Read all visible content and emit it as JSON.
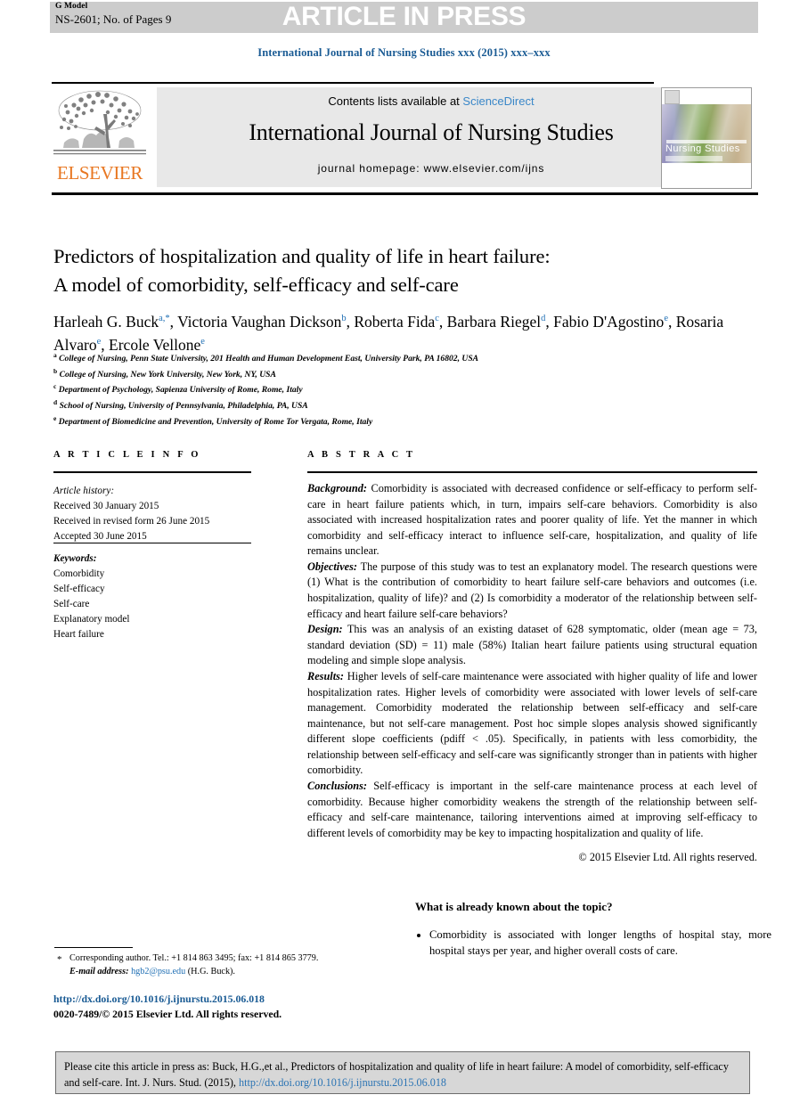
{
  "header": {
    "g_model_label": "G Model",
    "pages_line": "NS-2601; No. of Pages 9",
    "press_banner": "ARTICLE IN PRESS",
    "journal_ref": "International Journal of Nursing Studies xxx (2015) xxx–xxx"
  },
  "masthead": {
    "contents_prefix": "Contents lists available at ",
    "sciencedirect": "ScienceDirect",
    "journal_name": "International Journal of Nursing Studies",
    "homepage": "journal homepage: www.elsevier.com/ijns",
    "publisher": "ELSEVIER",
    "cover_title_main": "Nursing Studies"
  },
  "article": {
    "title_line_1": "Predictors of hospitalization and quality of life in heart failure:",
    "title_line_2": "A model of comorbidity, self-efficacy and self-care",
    "authors": [
      {
        "name": "Harleah G. Buck",
        "marks": "a,*",
        "sep": ", "
      },
      {
        "name": "Victoria Vaughan Dickson",
        "marks": "b",
        "sep": ", "
      },
      {
        "name": "Roberta Fida",
        "marks": "c",
        "sep": ", "
      },
      {
        "name": "Barbara Riegel",
        "marks": "d",
        "sep": ", "
      },
      {
        "name": "Fabio D'Agostino",
        "marks": "e",
        "sep": ", "
      },
      {
        "name": "Rosaria Alvaro",
        "marks": "e",
        "sep": ", "
      },
      {
        "name": "Ercole Vellone",
        "marks": "e",
        "sep": ""
      }
    ],
    "affiliations": [
      {
        "mark": "a",
        "text": "College of Nursing, Penn State University, 201 Health and Human Development East, University Park, PA 16802, USA"
      },
      {
        "mark": "b",
        "text": "College of Nursing, New York University, New York, NY, USA"
      },
      {
        "mark": "c",
        "text": "Department of Psychology, Sapienza University of Rome, Rome, Italy"
      },
      {
        "mark": "d",
        "text": "School of Nursing, University of Pennsylvania, Philadelphia, PA, USA"
      },
      {
        "mark": "e",
        "text": "Department of Biomedicine and Prevention, University of Rome Tor Vergata, Rome, Italy"
      }
    ]
  },
  "article_info": {
    "heading": "A R T I C L E   I N F O",
    "history_label": "Article history:",
    "history": [
      "Received 30 January 2015",
      "Received in revised form 26 June 2015",
      "Accepted 30 June 2015"
    ],
    "keywords_label": "Keywords:",
    "keywords": [
      "Comorbidity",
      "Self-efficacy",
      "Self-care",
      "Explanatory model",
      "Heart failure"
    ]
  },
  "abstract": {
    "heading": "A B S T R A C T",
    "sections": [
      {
        "label": "Background:",
        "text": " Comorbidity is associated with decreased confidence or self-efficacy to perform self-care in heart failure patients which, in turn, impairs self-care behaviors. Comorbidity is also associated with increased hospitalization rates and poorer quality of life. Yet the manner in which comorbidity and self-efficacy interact to influence self-care, hospitalization, and quality of life remains unclear."
      },
      {
        "label": "Objectives:",
        "text": " The purpose of this study was to test an explanatory model. The research questions were (1) What is the contribution of comorbidity to heart failure self-care behaviors and outcomes (i.e. hospitalization, quality of life)? and (2) Is comorbidity a moderator of the relationship between self-efficacy and heart failure self-care behaviors?"
      },
      {
        "label": "Design:",
        "text": " This was an analysis of an existing dataset of 628 symptomatic, older (mean age = 73, standard deviation (SD) = 11) male (58%) Italian heart failure patients using structural equation modeling and simple slope analysis."
      },
      {
        "label": "Results:",
        "text": " Higher levels of self-care maintenance were associated with higher quality of life and lower hospitalization rates. Higher levels of comorbidity were associated with lower levels of self-care management. Comorbidity moderated the relationship between self-efficacy and self-care maintenance, but not self-care management. Post hoc simple slopes analysis showed significantly different slope coefficients (pdiff < .05). Specifically, in patients with less comorbidity, the relationship between self-efficacy and self-care was significantly stronger than in patients with higher comorbidity."
      },
      {
        "label": "Conclusions:",
        "text": " Self-efficacy is important in the self-care maintenance process at each level of comorbidity. Because higher comorbidity weakens the strength of the relationship between self-efficacy and self-care maintenance, tailoring interventions aimed at improving self-efficacy to different levels of comorbidity may be key to impacting hospitalization and quality of life."
      }
    ],
    "copyright": "© 2015 Elsevier Ltd. All rights reserved."
  },
  "already_known": {
    "heading": "What is already known about the topic?",
    "bullets": [
      "Comorbidity is associated with longer lengths of hospital stay, more hospital stays per year, and higher overall costs of care."
    ]
  },
  "footnotes": {
    "star": "*",
    "corresponding": "Corresponding author. Tel.: +1 814 863 3495; fax: +1 814 865 3779.",
    "email_label": "E-mail address:",
    "email": "hgb2@psu.edu",
    "email_owner": " (H.G. Buck).",
    "doi": "http://dx.doi.org/10.1016/j.ijnurstu.2015.06.018",
    "issn": "0020-7489/© 2015 Elsevier Ltd. All rights reserved."
  },
  "cite_box": {
    "text_prefix": "Please cite this article in press as: Buck, H.G.,et al., Predictors of hospitalization and quality of life in heart failure: A model of comorbidity, self-efficacy and self-care. Int. J. Nurs. Stud. (2015), ",
    "link": "http://dx.doi.org/10.1016/j.ijnurstu.2015.06.018"
  },
  "colors": {
    "banner_gray": "#cccccc",
    "link_blue": "#1f6fb4",
    "elsevier_orange": "#e87722",
    "masthead_gray": "#e8e8e8",
    "cite_box_gray": "#d7d7d7"
  }
}
